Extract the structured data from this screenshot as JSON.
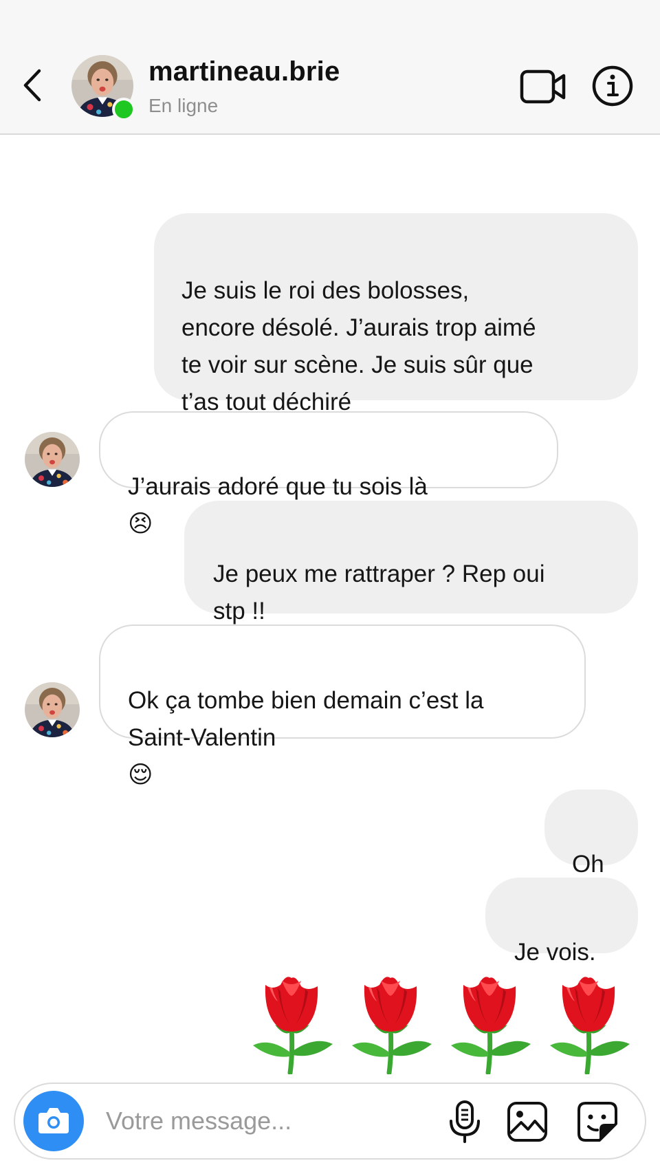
{
  "header": {
    "username": "martineau.brie",
    "status": "En ligne",
    "back_icon": "chevron-left-icon",
    "video_icon": "video-camera-icon",
    "info_icon": "info-icon"
  },
  "messages": [
    {
      "direction": "outgoing",
      "text": "Je suis le roi des bolosses,\nencore désolé. J’aurais trop aimé\nte voir sur scène. Je suis sûr que\nt’as tout déchiré"
    },
    {
      "direction": "incoming",
      "text": "J’aurais adoré que tu sois là",
      "emoji": "😣"
    },
    {
      "direction": "outgoing",
      "text": "Je peux me rattraper ? Rep oui\nstp !!"
    },
    {
      "direction": "incoming",
      "text": "Ok ça tombe bien demain c’est la\nSaint-Valentin",
      "emoji": "😌"
    },
    {
      "direction": "outgoing",
      "text": "Oh"
    },
    {
      "direction": "outgoing",
      "text": "Je vois."
    },
    {
      "direction": "outgoing",
      "emoji_message": "🌹🌹🌹🌹"
    }
  ],
  "composer": {
    "placeholder": "Votre message...",
    "camera_icon": "camera-icon",
    "mic_icon": "microphone-icon",
    "gallery_icon": "image-gallery-icon",
    "sticker_icon": "sticker-icon"
  },
  "colors": {
    "online": "#1ec721",
    "camera_button": "#2f8ef4",
    "outgoing_bubble": "#efefef",
    "incoming_border": "#dbdbdb",
    "rose_red": "#e0121e"
  }
}
